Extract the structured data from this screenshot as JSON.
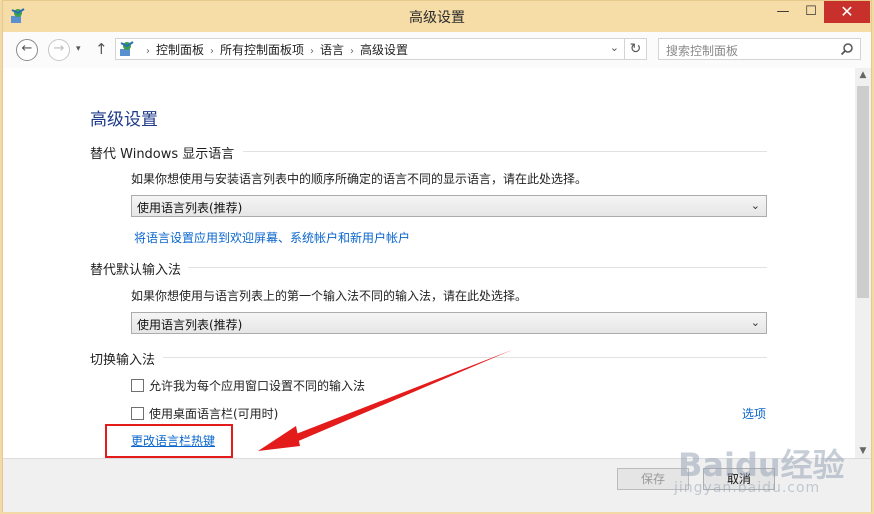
{
  "window": {
    "title": "高级设置",
    "controls": {
      "minimize": "—",
      "maximize": "☐",
      "close": "✕"
    }
  },
  "toolbar": {
    "back_icon": "←",
    "forward_icon": "→",
    "recent_icon": "▾",
    "up_icon": "↑",
    "breadcrumbs": [
      "控制面板",
      "所有控制面板项",
      "语言",
      "高级设置"
    ],
    "separator": "›",
    "address_dropdown": "⌄",
    "refresh_icon": "↻",
    "search_placeholder": "搜索控制面板"
  },
  "main": {
    "page_title": "高级设置",
    "display_language": {
      "heading": "替代 Windows 显示语言",
      "description": "如果你想使用与安装语言列表中的顺序所确定的语言不同的显示语言，请在此处选择。",
      "select_value": "使用语言列表(推荐)",
      "apply_link": "将语言设置应用到欢迎屏幕、系统帐户和新用户帐户"
    },
    "input_method": {
      "heading": "替代默认输入法",
      "description": "如果你想使用与语言列表上的第一个输入法不同的输入法，请在此处选择。",
      "select_value": "使用语言列表(推荐)"
    },
    "switching": {
      "heading": "切换输入法",
      "checkbox_per_app": "允许我为每个应用窗口设置不同的输入法",
      "checkbox_langbar": "使用桌面语言栏(可用时)",
      "options_link": "选项",
      "hotkey_link": "更改语言栏热键"
    }
  },
  "footer": {
    "save": "保存",
    "cancel": "取消"
  },
  "watermark": {
    "text": "Baidu经验",
    "url": "jingyan.baidu.com"
  },
  "colors": {
    "titlebar": "#f6dca7",
    "accent_link": "#0a66cc",
    "annotation_red": "#e31b1b",
    "close_button": "#c7302b"
  }
}
